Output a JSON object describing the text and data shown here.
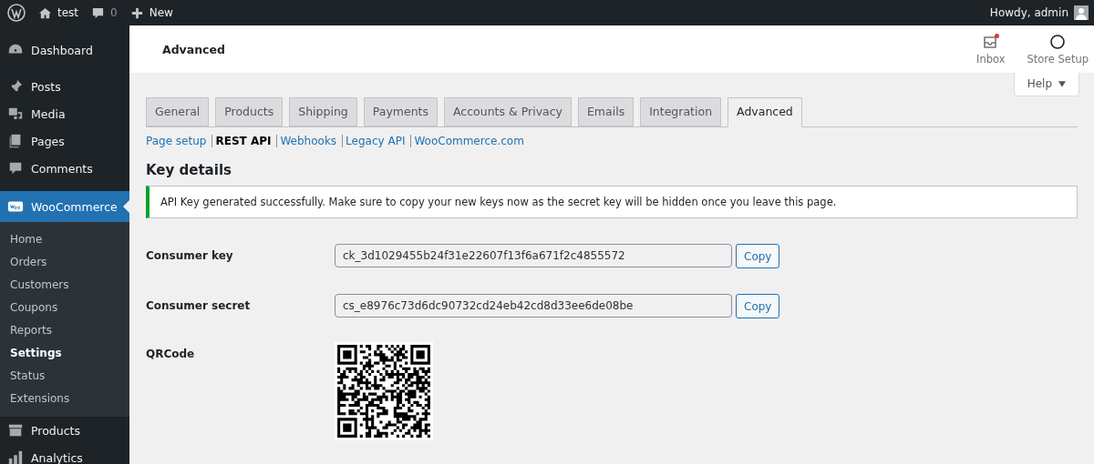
{
  "admin_bar": {
    "site": "test",
    "comments": "0",
    "new": "New",
    "greeting": "Howdy, admin"
  },
  "sidebar": {
    "items": [
      {
        "label": "Dashboard",
        "selected": false
      },
      {
        "label": "Posts",
        "selected": false
      },
      {
        "label": "Media",
        "selected": false
      },
      {
        "label": "Pages",
        "selected": false
      },
      {
        "label": "Comments",
        "selected": false
      },
      {
        "label": "WooCommerce",
        "selected": true,
        "children": [
          {
            "label": "Home",
            "selected": false
          },
          {
            "label": "Orders",
            "selected": false
          },
          {
            "label": "Customers",
            "selected": false
          },
          {
            "label": "Coupons",
            "selected": false
          },
          {
            "label": "Reports",
            "selected": false
          },
          {
            "label": "Settings",
            "selected": true
          },
          {
            "label": "Status",
            "selected": false
          },
          {
            "label": "Extensions",
            "selected": false
          }
        ]
      },
      {
        "label": "Products",
        "selected": false
      },
      {
        "label": "Analytics",
        "selected": false
      }
    ]
  },
  "header": {
    "title": "Advanced",
    "inbox": {
      "label": "Inbox",
      "unread": true
    },
    "store_setup": "Store Setup",
    "help": "Help"
  },
  "tabs": [
    {
      "label": "General",
      "selected": false
    },
    {
      "label": "Products",
      "selected": false
    },
    {
      "label": "Shipping",
      "selected": false
    },
    {
      "label": "Payments",
      "selected": false
    },
    {
      "label": "Accounts & Privacy",
      "selected": false
    },
    {
      "label": "Emails",
      "selected": false
    },
    {
      "label": "Integration",
      "selected": false
    },
    {
      "label": "Advanced",
      "selected": true
    }
  ],
  "sections": [
    {
      "label": "Page setup",
      "selected": false
    },
    {
      "label": "REST API",
      "selected": true
    },
    {
      "label": "Webhooks",
      "selected": false
    },
    {
      "label": "Legacy API",
      "selected": false
    },
    {
      "label": "WooCommerce.com",
      "selected": false
    }
  ],
  "heading": "Key details",
  "notice": "API Key generated successfully. Make sure to copy your new keys now as the secret key will be hidden once you leave this page.",
  "fields": [
    {
      "kind": "key",
      "label": "Consumer key",
      "value": "ck_3d1029455b24f31e22607f13f6a671f2c4855572",
      "button": "Copy"
    },
    {
      "kind": "key",
      "label": "Consumer secret",
      "value": "cs_e8976c73d6dc90732cd24eb42cd8d33ee6de08be",
      "button": "Copy"
    },
    {
      "kind": "qr",
      "label": "QRCode"
    }
  ]
}
